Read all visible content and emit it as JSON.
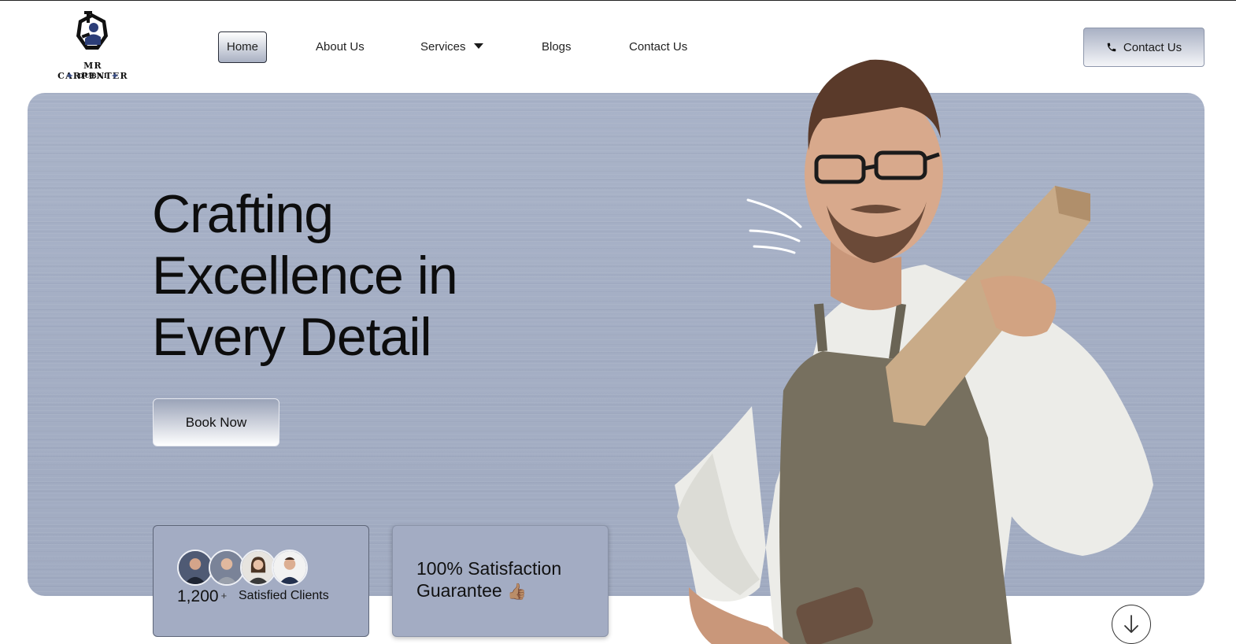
{
  "brand": {
    "name": "MR CARPENTER",
    "location": "DUBAI"
  },
  "nav": {
    "items": [
      {
        "label": "Home",
        "active": true
      },
      {
        "label": "About Us",
        "active": false
      },
      {
        "label": "Services",
        "active": false,
        "has_dropdown": true
      },
      {
        "label": "Blogs",
        "active": false
      },
      {
        "label": "Contact Us",
        "active": false
      }
    ]
  },
  "header_cta": {
    "label": "Contact Us",
    "icon": "phone-icon"
  },
  "hero": {
    "headline_lines": [
      "Crafting",
      "Excellence in",
      "Every Detail"
    ],
    "book_label": "Book Now",
    "clients": {
      "count": "1,200",
      "plus": "+",
      "label": "Satisfied Clients",
      "avatar_count": 4
    },
    "guarantee": {
      "line1": "100% Satisfaction",
      "line2": "Guarantee",
      "emoji": "👍🏽"
    }
  },
  "colors": {
    "hero_bg": "#a5afc5",
    "card_bg": "#a3acc3",
    "text": "#0d0d0d",
    "accent_star": "#3b4f86"
  },
  "icons": {
    "scroll": "arrow-down-icon",
    "dropdown": "caret-down-icon",
    "phone": "phone-icon"
  }
}
